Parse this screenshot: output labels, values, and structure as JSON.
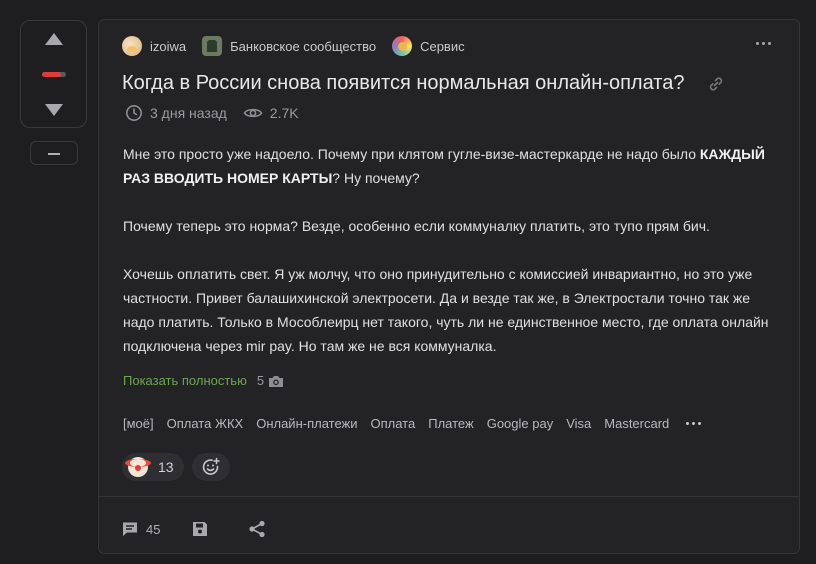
{
  "vote": {
    "rating_fill": 0.8,
    "colors": {
      "negative": "#e03b3b",
      "track": "#5a5a5e"
    }
  },
  "post": {
    "author": "izoiwa",
    "community": "Банковское сообщество",
    "service": "Сервис",
    "title": "Когда в России снова появится нормальная онлайн-оплата?",
    "time_ago": "3 дня назад",
    "views": "2.7K",
    "body": {
      "p1_before": "Мне это просто уже надоело. Почему при клятом гугле-визе-мастеркарде не надо было ",
      "p1_bold": "КАЖДЫЙ РАЗ ВВОДИТЬ НОМЕР КАРТЫ",
      "p1_after": "? Ну почему?",
      "p2": "Почему теперь это норма? Везде, особенно если коммуналку платить, это тупо прям бич.",
      "p3": "Хочешь оплатить свет. Я уж молчу, что оно принудительно с комиссией инвариантно, но это уже частности. Привет балашихинской электросети. Да и везде так же, в Электростали точно так же надо платить. Только в Мособлеирц нет такого, чуть ли не единственное место, где оплата онлайн подключена через mir pay. Но там же не вся коммуналка."
    },
    "show_full_label": "Показать полностью",
    "image_count": "5",
    "tags": [
      "[моё]",
      "Оплата ЖКХ",
      "Онлайн-платежи",
      "Оплата",
      "Платеж",
      "Google pay",
      "Visa",
      "Mastercard"
    ],
    "reactions": [
      {
        "icon": "clown-icon",
        "count": "13"
      }
    ],
    "comments_count": "45"
  },
  "colors": {
    "accent_link": "#6aa84f",
    "card_bg": "#232326",
    "page_bg": "#1e1e20"
  }
}
